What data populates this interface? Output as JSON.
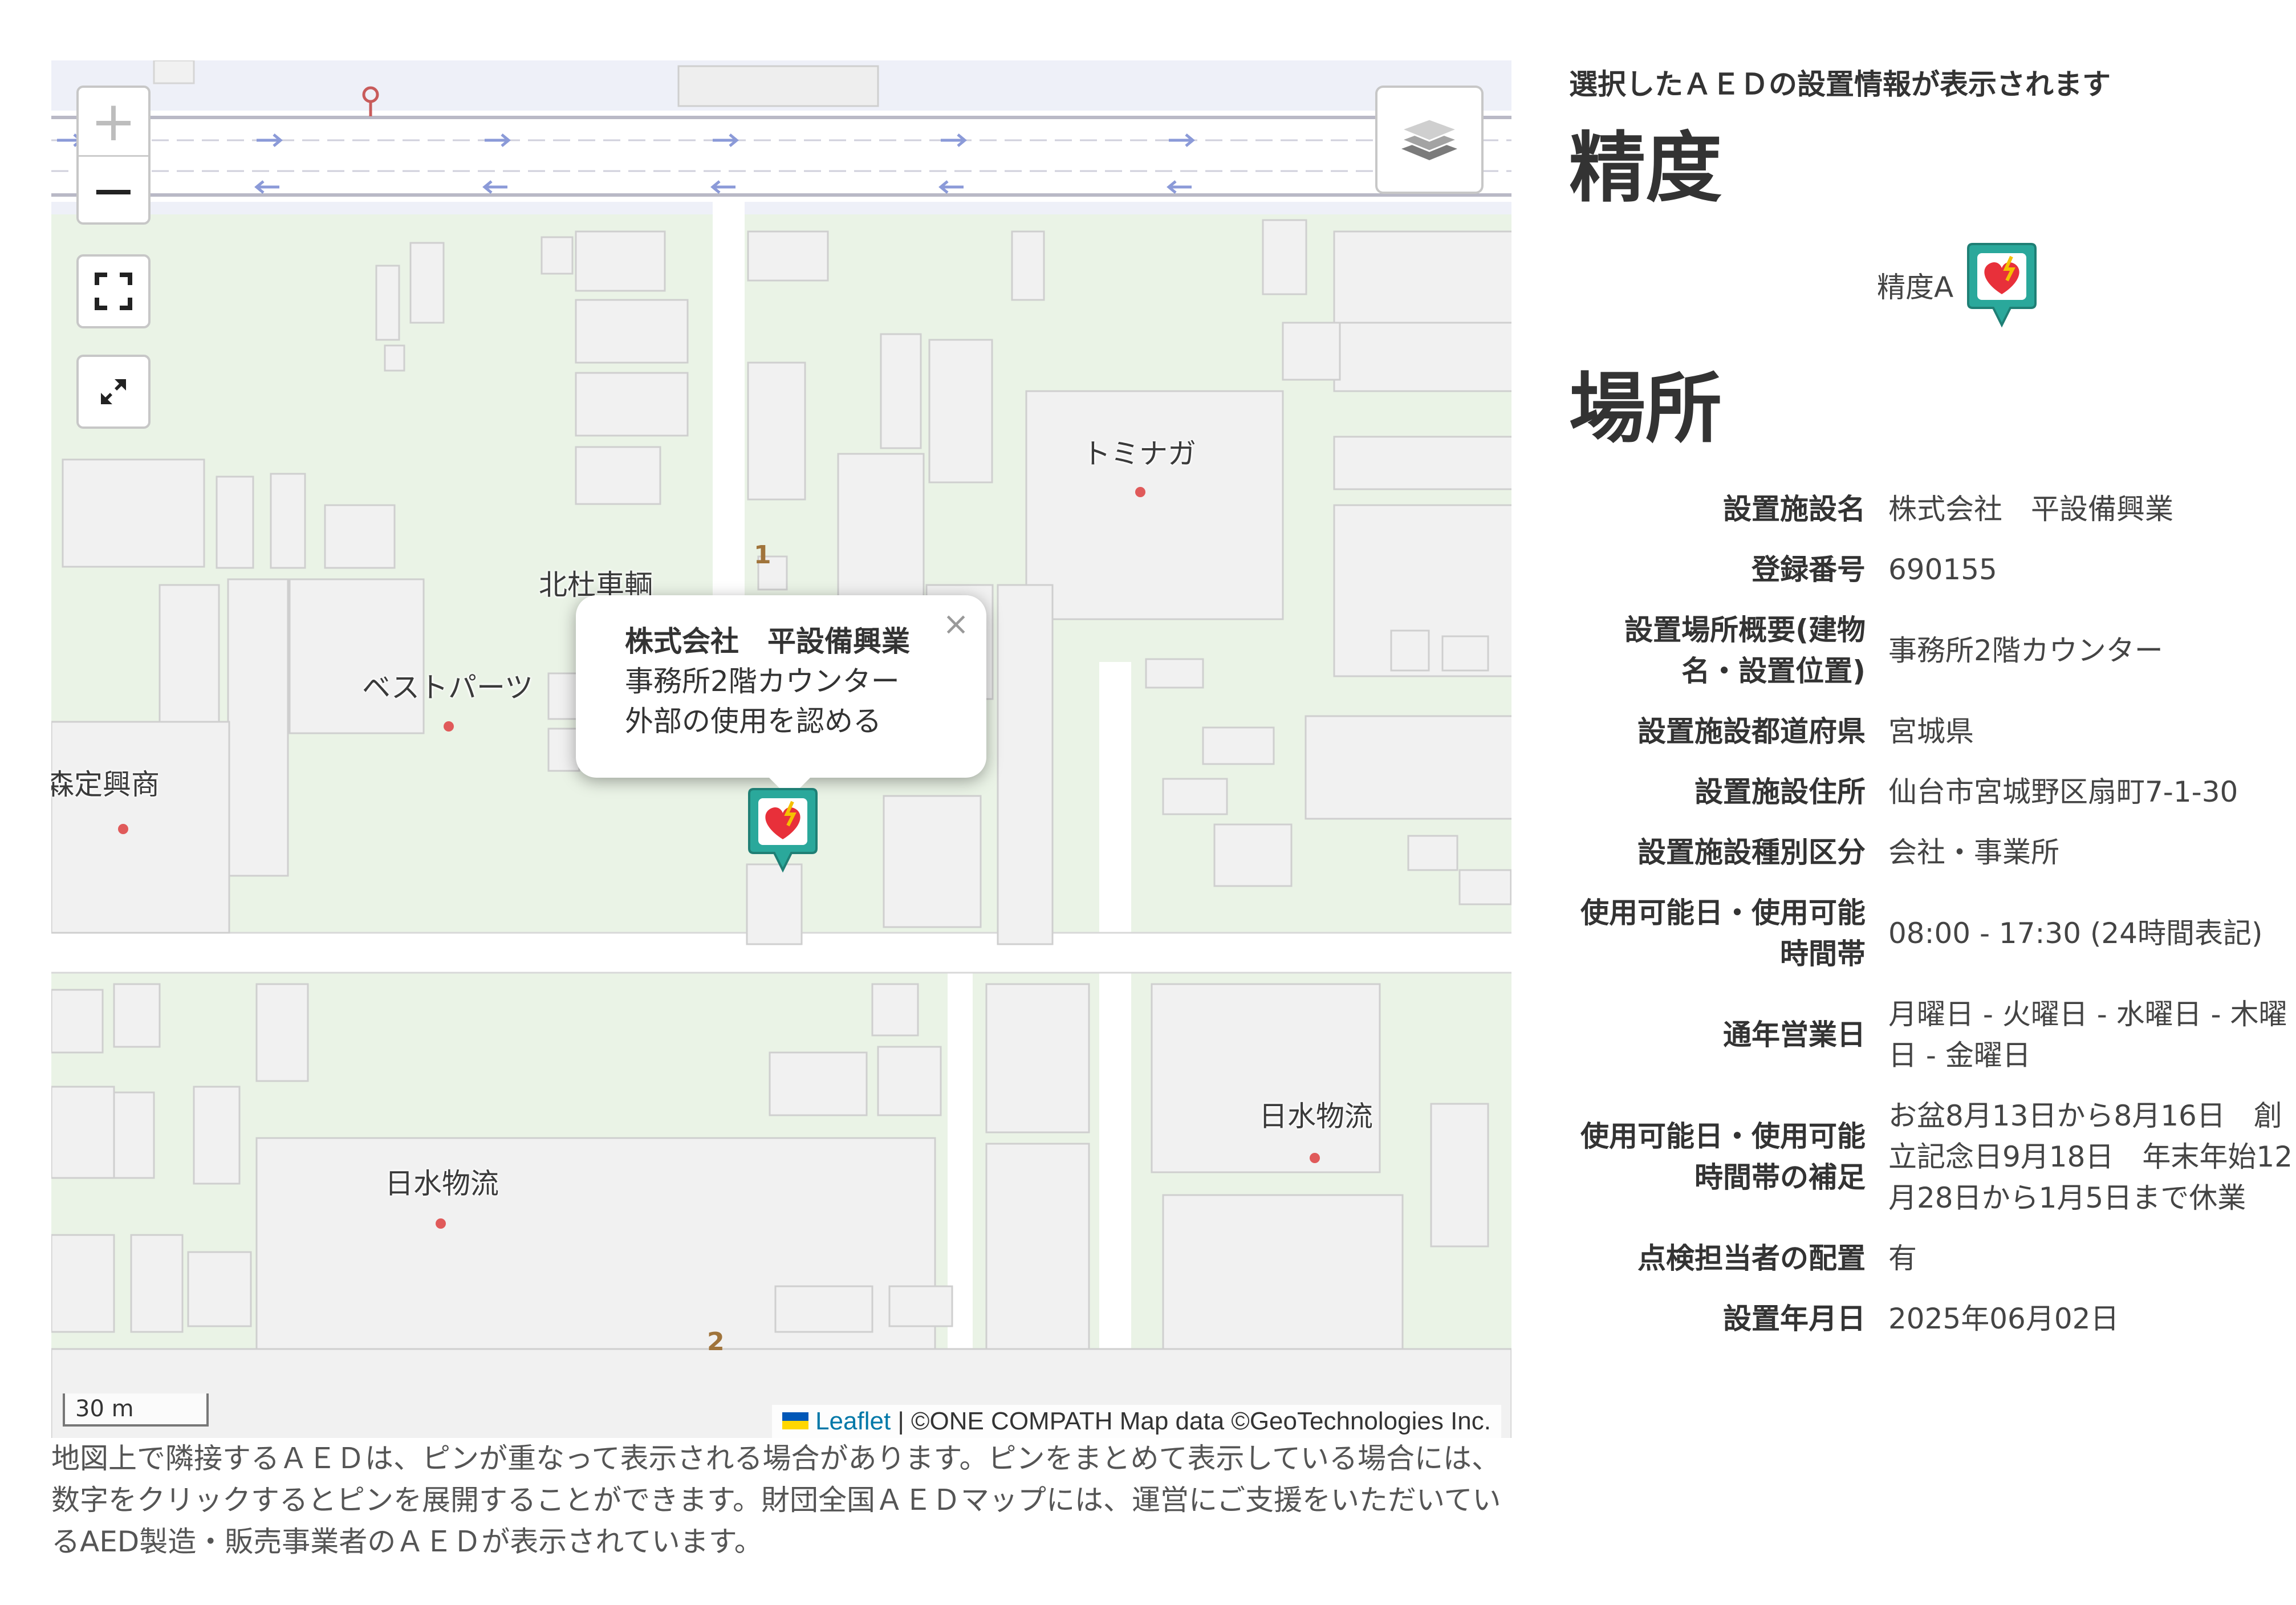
{
  "map": {
    "labels": {
      "tominaga": "トミナガ",
      "kitamura": "北杜車輌",
      "best_parts": "ベストパーツ",
      "morisada": "森定興商",
      "nissui_left": "日水物流",
      "nissui_right": "日水物流"
    },
    "cluster_numbers": {
      "one": "1",
      "two": "2"
    },
    "controls": {
      "zoom_in": "+",
      "zoom_out": "−"
    },
    "popup": {
      "title": "株式会社　平設備興業",
      "line1": "事務所2階カウンター",
      "line2": "外部の使用を認める",
      "close": "×"
    },
    "scale": "30 m",
    "attribution": {
      "leaflet": "Leaflet",
      "rest": " | ©ONE COMPATH Map data ©GeoTechnologies Inc."
    },
    "marker_colors": {
      "body": "#2aa89b",
      "heart": "#e8303a"
    }
  },
  "caption": "地図上で隣接するＡＥＤは、ピンが重なって表示される場合があります。ピンをまとめて表示している場合には、数字をクリックするとピンを展開することができます。財団全国ＡＥＤマップには、運営にご支援をいただいているAED製造・販売事業者のＡＥＤが表示されています。",
  "panel": {
    "intro": "選択したＡＥＤの設置情報が表示されます",
    "accuracy_heading": "精度",
    "accuracy_label": "精度A",
    "location_heading": "場所",
    "rows": [
      {
        "label": "設置施設名",
        "value": "株式会社　平設備興業"
      },
      {
        "label": "登録番号",
        "value": "690155"
      },
      {
        "label": "設置場所概要(建物名・設置位置)",
        "value": "事務所2階カウンター"
      },
      {
        "label": "設置施設都道府県",
        "value": "宮城県"
      },
      {
        "label": "設置施設住所",
        "value": "仙台市宮城野区扇町7-1-30"
      },
      {
        "label": "設置施設種別区分",
        "value": "会社・事業所"
      },
      {
        "label": "使用可能日・使用可能時間帯",
        "value": "08:00 - 17:30 (24時間表記)"
      },
      {
        "label": "通年営業日",
        "value": "月曜日 - 火曜日 - 水曜日 - 木曜日 - 金曜日"
      },
      {
        "label": "使用可能日・使用可能時間帯の補足",
        "value": "お盆8月13日から8月16日　創立記念日9月18日　年末年始12月28日から1月5日まで休業"
      },
      {
        "label": "点検担当者の配置",
        "value": "有"
      },
      {
        "label": "設置年月日",
        "value": "2025年06月02日"
      }
    ]
  }
}
